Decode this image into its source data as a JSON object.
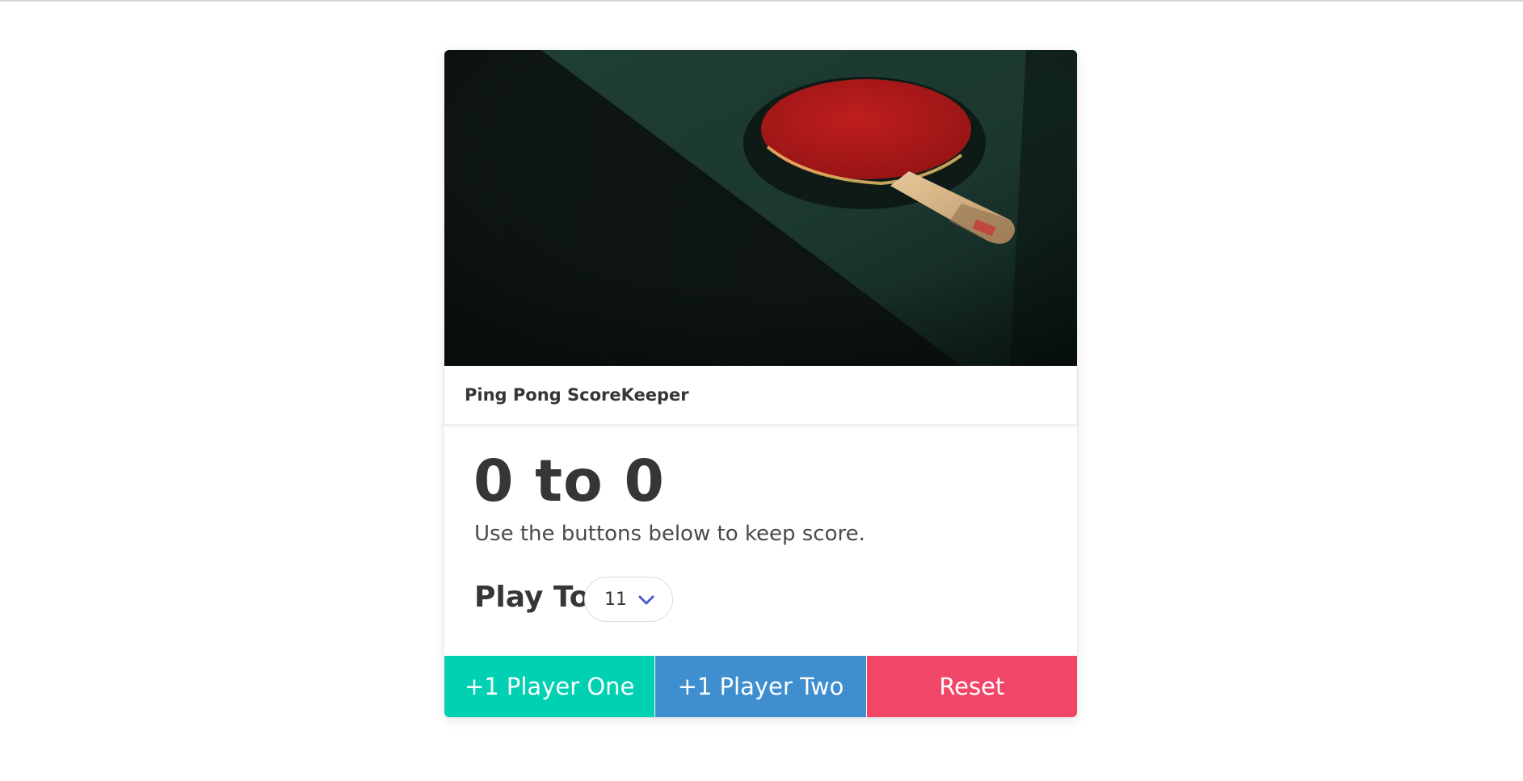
{
  "header": {
    "title": "Ping Pong ScoreKeeper"
  },
  "image": {
    "description_icon": "ping-pong-paddle-image"
  },
  "score": {
    "text": "0 to 0"
  },
  "subtitle": "Use the buttons below to keep score.",
  "play_to": {
    "label": "Play To:",
    "selected": "11",
    "icon": "chevron-down-icon"
  },
  "buttons": {
    "player_one": "+1 Player One",
    "player_two": "+1 Player Two",
    "reset": "Reset"
  },
  "colors": {
    "primary": "#00d1b2",
    "info": "#3e8ed0",
    "danger": "#f14668",
    "link": "#485fc7",
    "text": "#363636"
  }
}
